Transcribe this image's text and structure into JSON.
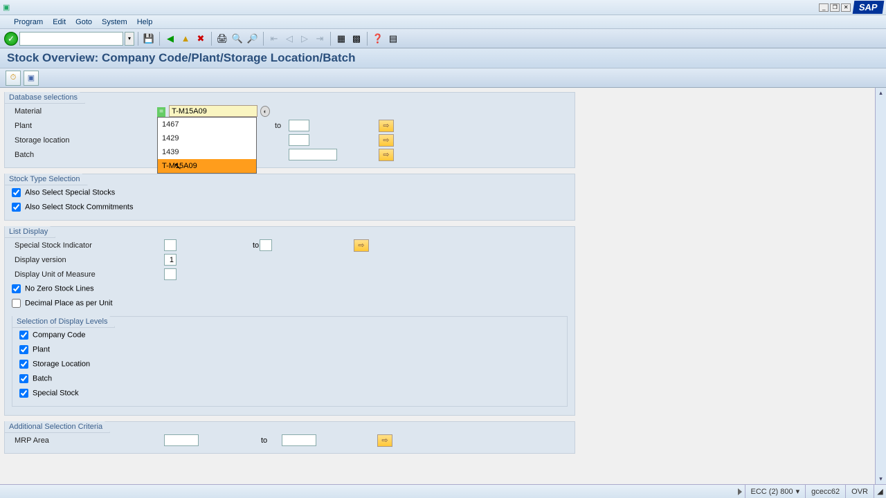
{
  "menu": {
    "program": "Program",
    "edit": "Edit",
    "goto": "Goto",
    "system": "System",
    "help": "Help"
  },
  "page_title": "Stock Overview: Company Code/Plant/Storage Location/Batch",
  "db_sel": {
    "title": "Database selections",
    "material_lbl": "Material",
    "plant_lbl": "Plant",
    "storage_lbl": "Storage location",
    "batch_lbl": "Batch",
    "to": "to",
    "material_value": "T-M15A09",
    "dropdown": [
      "1467",
      "1429",
      "1439",
      "T-M15A09"
    ]
  },
  "stock_type": {
    "title": "Stock Type Selection",
    "special": "Also Select Special Stocks",
    "commit": "Also Select Stock Commitments"
  },
  "list_disp": {
    "title": "List Display",
    "ssi": "Special Stock Indicator",
    "to": "to",
    "dv": "Display version",
    "dv_val": "1",
    "uom": "Display Unit of Measure",
    "nz": "No Zero Stock Lines",
    "dec": "Decimal Place as per Unit",
    "sel_levels": "Selection of Display Levels",
    "cc": "Company Code",
    "plant": "Plant",
    "sl": "Storage Location",
    "batch": "Batch",
    "ss": "Special Stock"
  },
  "add_crit": {
    "title": "Additional Selection Criteria",
    "mrp": "MRP Area",
    "to": "to"
  },
  "status": {
    "system": "ECC (2) 800",
    "server": "gcecc62",
    "mode": "OVR"
  }
}
